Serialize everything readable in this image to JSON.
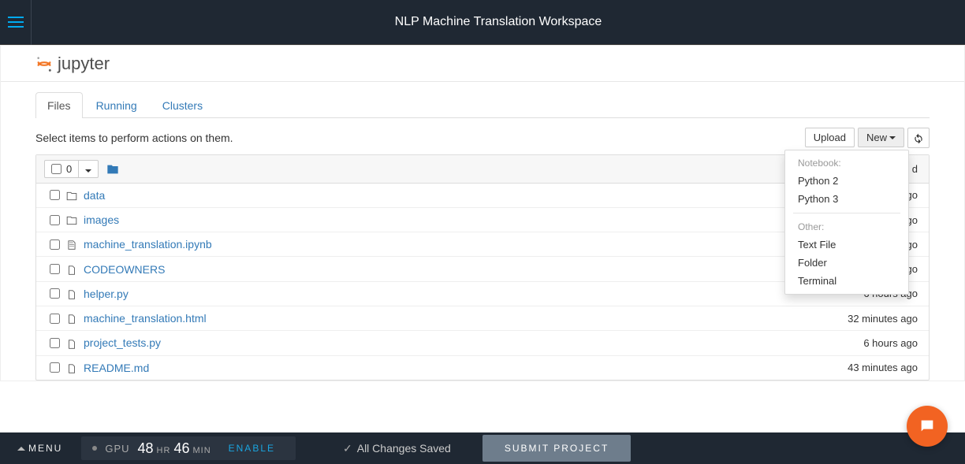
{
  "topbar": {
    "title": "NLP Machine Translation Workspace"
  },
  "jupyter_logo_text": "jupyter",
  "tabs": {
    "files": "Files",
    "running": "Running",
    "clusters": "Clusters"
  },
  "action_row": {
    "hint": "Select items to perform actions on them.",
    "upload": "Upload",
    "new": "New"
  },
  "new_menu": {
    "header_notebook": "Notebook:",
    "python2": "Python 2",
    "python3": "Python 3",
    "header_other": "Other:",
    "textfile": "Text File",
    "folder": "Folder",
    "terminal": "Terminal"
  },
  "file_header": {
    "selected_count": "0",
    "last_modified_partial": "d"
  },
  "files": [
    {
      "type": "dir",
      "name": "data",
      "modified": "go"
    },
    {
      "type": "dir",
      "name": "images",
      "modified": "go"
    },
    {
      "type": "notebook",
      "name": "machine_translation.ipynb",
      "modified": "go"
    },
    {
      "type": "file",
      "name": "CODEOWNERS",
      "modified": "go"
    },
    {
      "type": "file",
      "name": "helper.py",
      "modified": "6 hours ago"
    },
    {
      "type": "file",
      "name": "machine_translation.html",
      "modified": "32 minutes ago"
    },
    {
      "type": "file",
      "name": "project_tests.py",
      "modified": "6 hours ago"
    },
    {
      "type": "file",
      "name": "README.md",
      "modified": "43 minutes ago"
    }
  ],
  "bottombar": {
    "menu": "MENU",
    "gpu": "GPU",
    "hours": "48",
    "hr": "HR",
    "minutes": "46",
    "min": "MIN",
    "enable": "ENABLE",
    "save_status": "All Changes Saved",
    "submit": "SUBMIT PROJECT"
  }
}
